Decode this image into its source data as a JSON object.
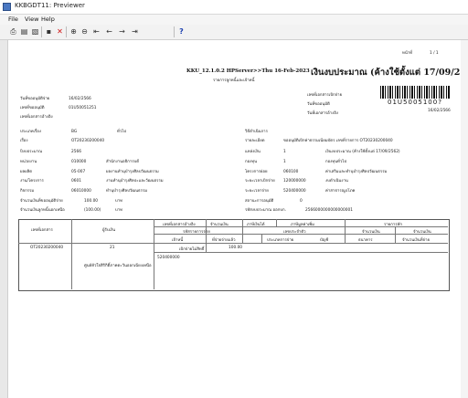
{
  "window": {
    "title": "KKBGDT11: Previewer"
  },
  "menu": {
    "file": "File",
    "view": "View",
    "help": "Help"
  },
  "toolbar": {
    "page_value": "1",
    "help_glyph": "?"
  },
  "report": {
    "page_label": "หน้าที่",
    "page_text": "1  /  1",
    "system_line": "KKU_12.1.0.2 HPServer>>Thu 16-Feb-2023",
    "report_subtitle": "รายการลูกหนี้และเจ้าหนี้",
    "main_title": "เงินงบประมาณ (ค้างใช้ตั้งแต่ 17/09/2562)",
    "barcode_text": "01U5005100?",
    "barcode_date": "16/02/2566",
    "left_block": [
      {
        "label": "วันที่ขออนุมัติจ่าย",
        "value": "16/02/2566"
      },
      {
        "label": "เลขที่ขออนุมัติ",
        "value": "01U50051251"
      },
      {
        "label": "เลขที่เอกสารอ้างอิง",
        "value": ""
      }
    ],
    "right_block": [
      {
        "label": "เลขที่เอกสารเบิกจ่าย",
        "value": ""
      },
      {
        "label": "วันที่ขออนุมัติ",
        "value": "16/02/2566"
      },
      {
        "label": "วันที่เอกสารอ้างอิง",
        "value": ""
      }
    ],
    "detail_left": [
      {
        "label": "ประเภทเรื่อง",
        "c1": "BG",
        "c2": "ทั่วไป"
      },
      {
        "label": "เรื่อง",
        "c1": "OT20230200040",
        "c2": ""
      },
      {
        "label": "ปีงบประมาณ",
        "c1": "2566",
        "c2": ""
      },
      {
        "label": "หน่วยงาน",
        "c1": "010000",
        "c2": "สำนักงานอธิการบดี"
      },
      {
        "label": "ผลผลิต",
        "c1": "05-007",
        "c2": "ผลงานทำนุบำรุงศิลปวัฒนธรรม"
      },
      {
        "label": "งาน/โครงการ",
        "c1": "0601",
        "c2": "งานทำนุบำรุงศิลปะและวัฒนธรรม"
      },
      {
        "label": "กิจกรรม",
        "c1": "06010000",
        "c2": "ทำนุบำรุงศิลปวัฒนธรรม"
      },
      {
        "label": "จำนวนเงินที่ขออนุมัติจ่าย",
        "c1": "100.00",
        "c2": "บาท"
      },
      {
        "label": "จำนวนเงินลูกหนี้นอกเหนือ",
        "c1": "(100.00)",
        "c2": "บาท"
      }
    ],
    "detail_right": [
      {
        "label": "วิธีดำเนินการ",
        "c1": "",
        "c2": ""
      },
      {
        "label": "รายละเอียด",
        "c1": "ขออนุมัติเบิกค่าธรรมเนียมบัตร เลขที่รายการ OT20230200040",
        "c2": ""
      },
      {
        "label": "แหล่งเงิน",
        "c1": "1",
        "c2": "เงินงบประมาณ (ค้างใช้ตั้งแต่ 17/09/2562)"
      },
      {
        "label": "กองทุน",
        "c1": "1",
        "c2": "กองทุนทั่วไป"
      },
      {
        "label": "โครงการย่อย",
        "c1": "060100",
        "c2": "ค่าเสริมและทำนุบำรุงศิลปวัฒนธรรม"
      },
      {
        "label": "ระยะเวลาเบิกจ่าย",
        "c1": "120000000",
        "c2": "งบดำเนินงาน"
      },
      {
        "label": "ระยะเวลาจ่าย",
        "c1": "520400000",
        "c2": "ค่าสาธารณูปโภค"
      },
      {
        "label": "สถานะการอนุมัติ",
        "c1": "0",
        "c2": ""
      },
      {
        "label": "รหัสงบประมาณ ออกบก.",
        "c1": "2566000000000000001",
        "c2": ""
      }
    ],
    "table": {
      "h_docno": "เลขที่เอกสาร",
      "h_payee": "ผู้รับเงิน",
      "h_refdoc": "เลขที่เอกสารอ้างอิง",
      "h_amount": "จำนวนเงิน",
      "h_tax": "ภาษีเงินได้",
      "h_vat": "ภาษีมูลค่าเพิ่ม",
      "h_deduct": "รายการหัก",
      "h_itemcode": "รหัสรายการจ่าย",
      "h_taxid": "เลขประจำตัว",
      "h_amount2": "จำนวนเงิน",
      "h_payer": "เจ้าหนี้",
      "h_paid": "ที่จ่ายจ่ายแล้ว",
      "h_paytype": "ประเภทการจ่าย",
      "h_account": "บัญชี",
      "h_bank": "ธนาคาร",
      "h_remain": "จำนวนเงินที่จ่าย",
      "row_docno": "OT20230200040",
      "row_no": "21",
      "row_desc": "เบิกจ่ายไม่สิทธิ์",
      "row_amount": "100.00",
      "row_code": "520400000",
      "row_note": "ศูนย์หัวใจสิริกิติ์ภาคตะวันออกเฉียงเหนือ"
    }
  }
}
